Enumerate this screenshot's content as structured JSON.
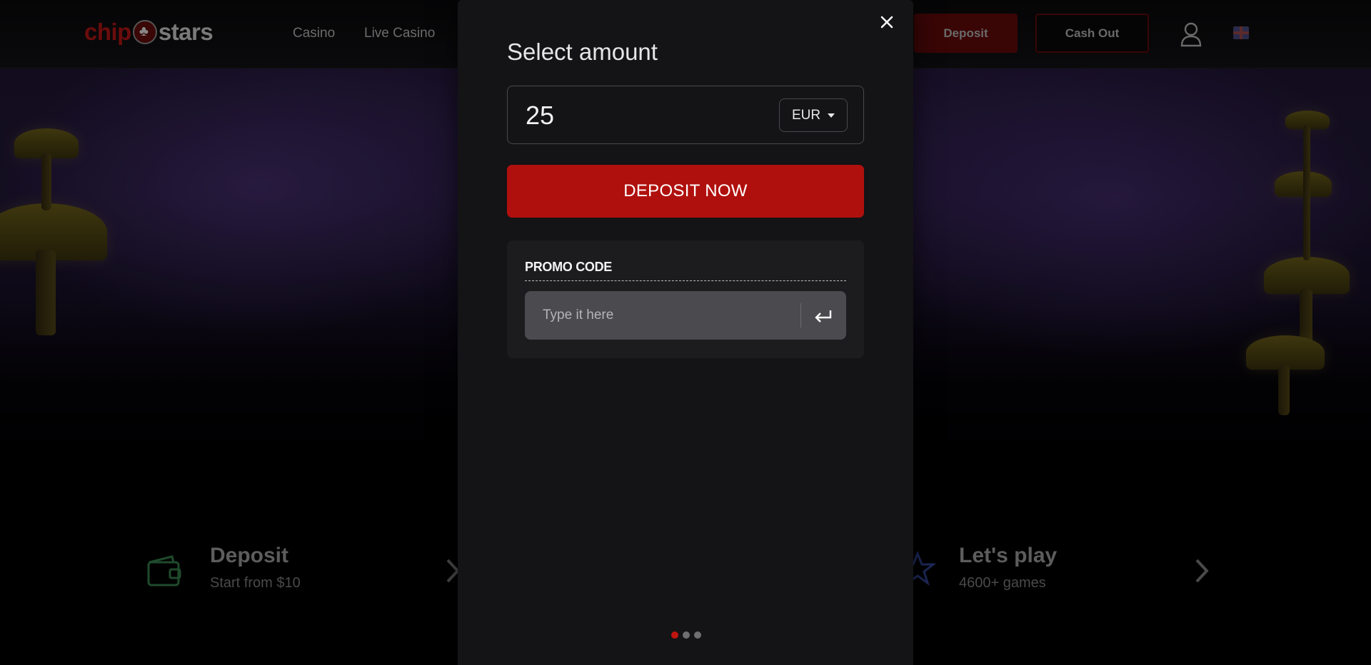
{
  "site": {
    "logo_part1": "chip",
    "logo_part2": "stars",
    "nav": {
      "casino": "Casino",
      "live_casino": "Live Casino"
    },
    "header_buttons": {
      "deposit": "Deposit",
      "cash_out": "Cash Out"
    },
    "steps": {
      "left": {
        "title": "Deposit",
        "subtitle": "Start from $10"
      },
      "right": {
        "title": "Let's play",
        "subtitle": "4600+ games"
      }
    }
  },
  "modal": {
    "title": "Select amount",
    "amount": "25",
    "currency": "EUR",
    "deposit_button": "DEPOSIT NOW",
    "promo": {
      "label": "PROMO CODE",
      "placeholder": "Type it here"
    },
    "pagination": {
      "total": 3,
      "active": 1
    }
  },
  "colors": {
    "accent_red": "#b0100d",
    "modal_bg": "#141315",
    "promo_card_bg": "#1c1b1e",
    "promo_input_bg": "#4b4a4e"
  }
}
